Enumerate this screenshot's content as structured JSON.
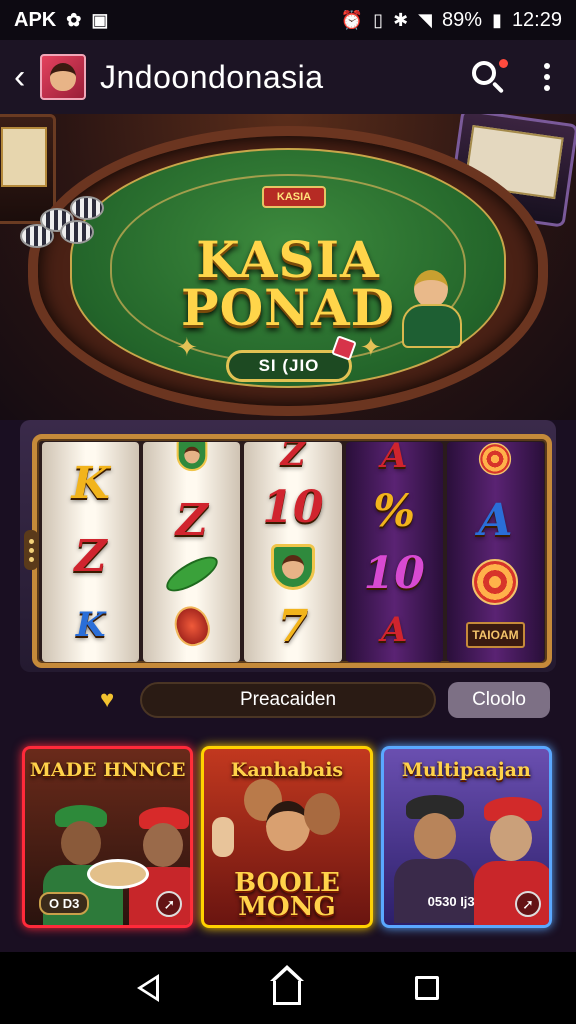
{
  "status_bar": {
    "left_text": "APK",
    "battery": "89%",
    "time": "12:29"
  },
  "app_bar": {
    "title": "Jndoondonasia"
  },
  "hero": {
    "title_line1": "KASIA",
    "title_line2": "PONAD",
    "badge": "KASIA",
    "button_label": "SI (JIO"
  },
  "slot": {
    "reels": [
      {
        "style": "light",
        "symbols": [
          {
            "t": "K",
            "c": "gold"
          },
          {
            "t": "Z",
            "c": "red"
          },
          {
            "t": "K",
            "c": "blue"
          }
        ]
      },
      {
        "style": "light",
        "symbols": [
          {
            "t": "Z",
            "c": "red"
          }
        ]
      },
      {
        "style": "light",
        "symbols": [
          {
            "t": "10",
            "c": "red"
          },
          {
            "t": "7",
            "c": "gold"
          }
        ]
      },
      {
        "style": "dark",
        "symbols": [
          {
            "t": "%",
            "c": "gold"
          },
          {
            "t": "10",
            "c": "pink"
          },
          {
            "t": "A",
            "c": "red"
          }
        ]
      },
      {
        "style": "dark",
        "symbols": [
          {
            "t": "A",
            "c": "blue"
          }
        ],
        "tag": "TAIOAM"
      }
    ]
  },
  "action_row": {
    "input_value": "Preacaiden",
    "button_label": "Cloolo"
  },
  "cards": [
    {
      "title": "MADE HNNCE",
      "badge": "O D3"
    },
    {
      "title": "Kanhabais",
      "bottom_title_line1": "BOOLE",
      "bottom_title_line2": "MONG"
    },
    {
      "title": "Multipaajan",
      "badge": "0530 Ij3"
    }
  ],
  "colors": {
    "app_bar_bg": "#1c1424",
    "felt_green": "#23652a",
    "gold": "#ffd54a",
    "card1_border": "#ff2a3a",
    "card2_border": "#ffd200",
    "card3_border": "#5aa8ff"
  }
}
